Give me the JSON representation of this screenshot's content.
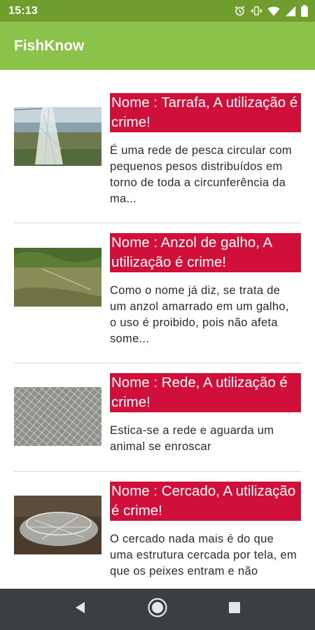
{
  "status_bar": {
    "time": "15:13",
    "icons": [
      "alarm-icon",
      "vibrate-icon",
      "wifi-icon",
      "signal-icon",
      "battery-icon"
    ]
  },
  "app_bar": {
    "title": "FishKnow"
  },
  "colors": {
    "status_bar": "#6f9e2f",
    "app_bar": "#8bc34a",
    "title_highlight": "#d0103a",
    "nav_bar": "#3b3f43"
  },
  "items": [
    {
      "title": "Nome : Tarrafa, A utilização é crime!",
      "description": "É uma rede de pesca circular com pequenos pesos distribuídos em torno de toda a circunferência da ma...",
      "image": "tarrafa-photo"
    },
    {
      "title": "Nome : Anzol de galho, A utilização é crime!",
      "description": "Como o nome já diz, se trata de um anzol amarrado em um galho, o uso é proibido, pois não afeta some...",
      "image": "anzol-photo"
    },
    {
      "title": "Nome : Rede, A utilização é crime!",
      "description": "Estica-se a rede e aguarda um animal se enroscar",
      "image": "rede-photo"
    },
    {
      "title": "Nome : Cercado, A utilização é crime!",
      "description": "O cercado nada mais é do que uma estrutura cercada por tela, em que os peixes entram e não",
      "image": "cercado-photo"
    }
  ],
  "nav_bar": {
    "buttons": [
      "back-icon",
      "home-icon",
      "recents-icon"
    ]
  }
}
